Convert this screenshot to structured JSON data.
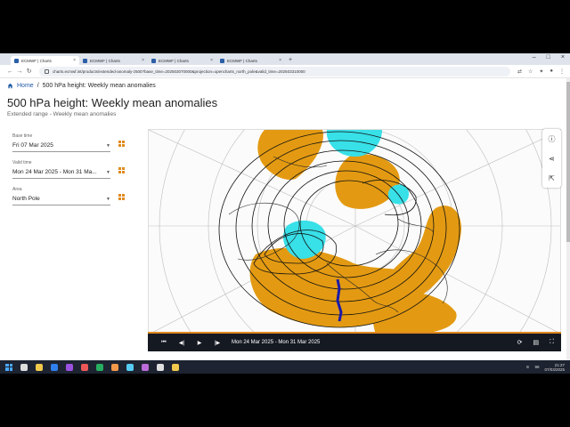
{
  "browser": {
    "tabs": [
      {
        "label": "ECMWF | Charts",
        "active": true
      },
      {
        "label": "ECMWF | Charts",
        "active": false
      },
      {
        "label": "ECMWF | Charts",
        "active": false
      },
      {
        "label": "ECMWF | Charts",
        "active": false
      }
    ],
    "new_tab": "+",
    "url": "charts.ecmwf.int/products/extended-anomaly-z500?base_time=202503070000&projection=opencharts_north_pole&valid_time=202503310000"
  },
  "breadcrumb": {
    "home": "Home",
    "separator": "/",
    "current": "500 hPa height: Weekly mean anomalies"
  },
  "page": {
    "title": "500 hPa height: Weekly mean anomalies",
    "subtitle": "Extended range - Weekly mean anomalies"
  },
  "controls": {
    "base_time": {
      "label": "Base time",
      "value": "Fri 07 Mar 2025"
    },
    "valid_time": {
      "label": "Valid time",
      "value": "Mon 24 Mar 2025 - Mon 31 Ma..."
    },
    "area": {
      "label": "Area",
      "value": "North Pole"
    }
  },
  "player": {
    "date_range": "Mon 24 Mar 2025 - Mon 31 Mar 2025",
    "progress": 1.0
  },
  "taskbar": {
    "time": "21:27",
    "date": "07/03/2025",
    "battery": "98"
  },
  "colors": {
    "positive_anomaly": "#e39a12",
    "negative_anomaly": "#38e0e8",
    "accent": "#e08a1e",
    "link": "#1f5aa6"
  }
}
